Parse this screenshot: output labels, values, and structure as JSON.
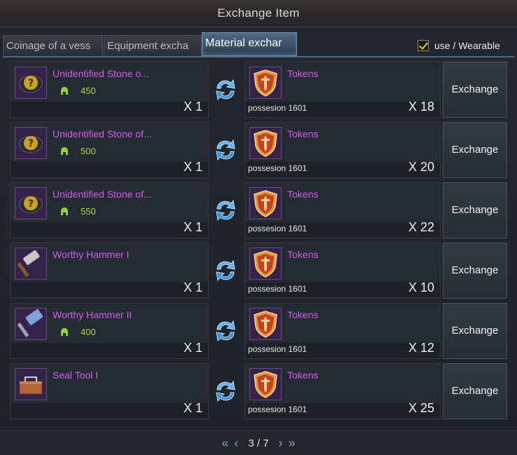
{
  "window": {
    "title": "Exchange Item"
  },
  "tabs": [
    {
      "label": "Coinage of a vess"
    },
    {
      "label": "Equipment excha"
    },
    {
      "label": "Material exchar"
    }
  ],
  "filter": {
    "label": "use / Wearable",
    "checked": true
  },
  "rows": [
    {
      "item_name": "Unidentified Stone o...",
      "item_icon": "unidentified-stone-icon",
      "item_req": "450",
      "item_qty": "X 1",
      "token_name": "Tokens",
      "token_icon": "token-shield-icon",
      "possession": "possesion 1601",
      "token_qty": "X 18",
      "button": "Exchange"
    },
    {
      "item_name": "Unidentified Stone of...",
      "item_icon": "unidentified-stone-icon",
      "item_req": "500",
      "item_qty": "X 1",
      "token_name": "Tokens",
      "token_icon": "token-shield-icon",
      "possession": "possesion 1601",
      "token_qty": "X 20",
      "button": "Exchange"
    },
    {
      "item_name": "Unidentified Stone of...",
      "item_icon": "unidentified-stone-icon",
      "item_req": "550",
      "item_qty": "X 1",
      "token_name": "Tokens",
      "token_icon": "token-shield-icon",
      "possession": "possesion 1601",
      "token_qty": "X 22",
      "button": "Exchange"
    },
    {
      "item_name": "Worthy Hammer I",
      "item_icon": "hammer-icon",
      "item_req": "",
      "item_qty": "X 1",
      "token_name": "Tokens",
      "token_icon": "token-shield-icon",
      "possession": "possesion 1601",
      "token_qty": "X 10",
      "button": "Exchange"
    },
    {
      "item_name": "Worthy Hammer II",
      "item_icon": "blue-hammer-icon",
      "item_req": "400",
      "item_qty": "X 1",
      "token_name": "Tokens",
      "token_icon": "token-shield-icon",
      "possession": "possesion 1601",
      "token_qty": "X 12",
      "button": "Exchange"
    },
    {
      "item_name": "Seal Tool I",
      "item_icon": "toolbox-icon",
      "item_req": "",
      "item_qty": "X 1",
      "token_name": "Tokens",
      "token_icon": "token-shield-icon",
      "possession": "possesion 1601",
      "token_qty": "X 25",
      "button": "Exchange"
    }
  ],
  "pager": {
    "first": "«",
    "prev": "‹",
    "page": "3 / 7",
    "next": "›",
    "last": "»"
  },
  "colors": {
    "item_name": "#d45bf2",
    "requirement": "#a8d64a",
    "active_tab": "#4f6b86"
  }
}
